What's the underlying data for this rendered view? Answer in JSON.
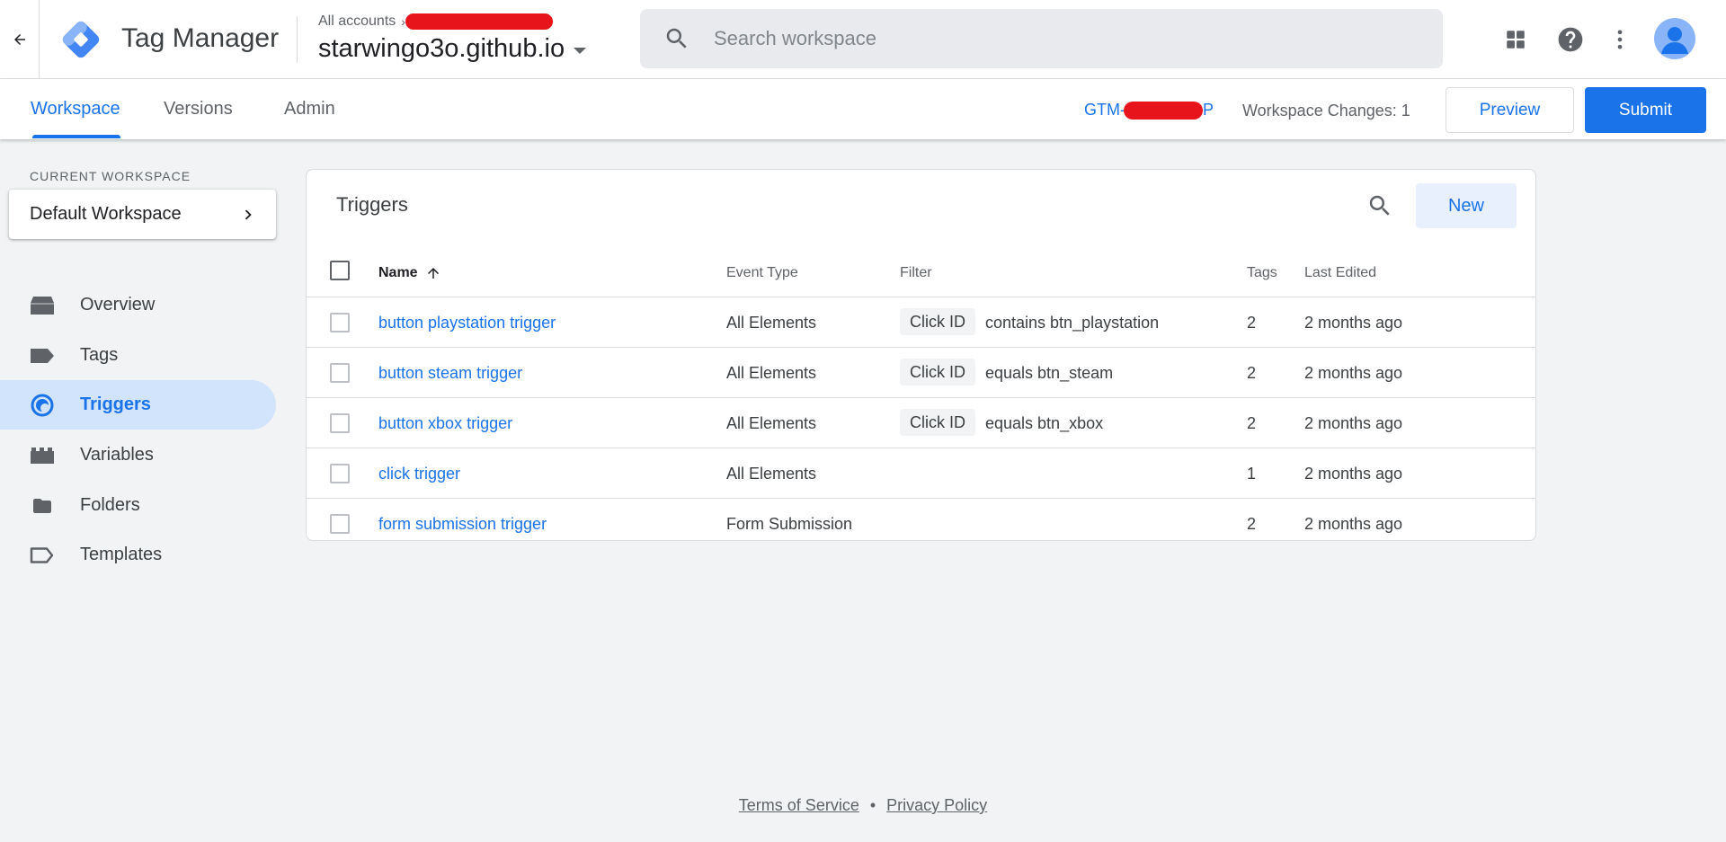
{
  "header": {
    "product_name": "Tag Manager",
    "account_label": "All accounts",
    "account_separator": "›",
    "container_name": "starwingo3o.github.io",
    "search_placeholder": "Search workspace"
  },
  "tabs": {
    "workspace": "Workspace",
    "versions": "Versions",
    "admin": "Admin",
    "active": "Workspace"
  },
  "toolbar": {
    "gtm_prefix": "GTM-",
    "gtm_suffix": "P",
    "workspace_changes": "Workspace Changes: 1",
    "preview_label": "Preview",
    "submit_label": "Submit"
  },
  "sidebar": {
    "workspace_heading": "CURRENT WORKSPACE",
    "workspace_name": "Default Workspace",
    "items": [
      {
        "label": "Overview",
        "icon": "overview-icon",
        "active": false
      },
      {
        "label": "Tags",
        "icon": "tag-icon",
        "active": false
      },
      {
        "label": "Triggers",
        "icon": "trigger-icon",
        "active": true
      },
      {
        "label": "Variables",
        "icon": "variables-icon",
        "active": false
      },
      {
        "label": "Folders",
        "icon": "folder-icon",
        "active": false
      },
      {
        "label": "Templates",
        "icon": "template-icon",
        "active": false
      }
    ]
  },
  "triggers": {
    "title": "Triggers",
    "new_label": "New",
    "columns": {
      "name": "Name",
      "event_type": "Event Type",
      "filter": "Filter",
      "tags": "Tags",
      "last_edited": "Last Edited"
    },
    "rows": [
      {
        "name": "button playstation trigger",
        "event_type": "All Elements",
        "filter_var": "Click ID",
        "filter_expr": "contains btn_playstation",
        "tags": "2",
        "last_edited": "2 months ago"
      },
      {
        "name": "button steam trigger",
        "event_type": "All Elements",
        "filter_var": "Click ID",
        "filter_expr": "equals btn_steam",
        "tags": "2",
        "last_edited": "2 months ago"
      },
      {
        "name": "button xbox trigger",
        "event_type": "All Elements",
        "filter_var": "Click ID",
        "filter_expr": "equals btn_xbox",
        "tags": "2",
        "last_edited": "2 months ago"
      },
      {
        "name": "click trigger",
        "event_type": "All Elements",
        "filter_var": "",
        "filter_expr": "",
        "tags": "1",
        "last_edited": "2 months ago"
      },
      {
        "name": "form submission trigger",
        "event_type": "Form Submission",
        "filter_var": "",
        "filter_expr": "",
        "tags": "2",
        "last_edited": "2 months ago"
      }
    ]
  },
  "footer": {
    "terms": "Terms of Service",
    "separator": "•",
    "privacy": "Privacy Policy"
  },
  "colors": {
    "accent": "#1a73e8",
    "active_nav_bg": "#d2e3fc",
    "page_bg": "#f1f3f4",
    "redaction": "#e8141c"
  }
}
